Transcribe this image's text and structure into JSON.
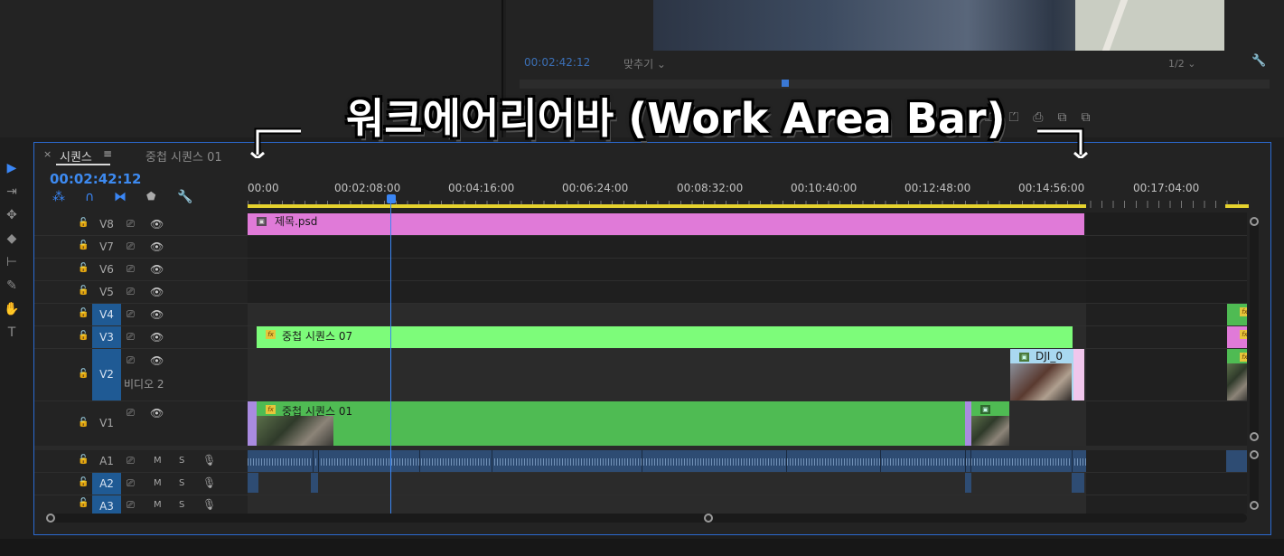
{
  "overlay": {
    "title": "워크에어리어바 (Work Area Bar)"
  },
  "monitor": {
    "timecode": "00:02:42:12",
    "fit": "맞추기  ⌄",
    "resolution": "1/2  ⌄",
    "controls": "⏍⏍⎙⧉⧉"
  },
  "tabs": {
    "close": "×",
    "sequence": "시퀀스",
    "menu": "≡",
    "nested": "중첩 시퀀스 01"
  },
  "timeline": {
    "timecode": "00:02:42:12",
    "ruler_labels": [
      "00:00",
      "00:02:08:00",
      "00:04:16:00",
      "00:06:24:00",
      "00:08:32:00",
      "00:10:40:00",
      "00:12:48:00",
      "00:14:56:00",
      "00:17:04:00"
    ],
    "work_area": {
      "start": "00:00:00:00",
      "end": "00:14:56:00"
    },
    "playhead": "00:02:42:12"
  },
  "tracks": {
    "video": [
      {
        "name": "V8",
        "active": false
      },
      {
        "name": "V7",
        "active": false
      },
      {
        "name": "V6",
        "active": false
      },
      {
        "name": "V5",
        "active": false
      },
      {
        "name": "V4",
        "active": true
      },
      {
        "name": "V3",
        "active": true
      },
      {
        "name": "V2",
        "active": true,
        "label": "비디오 2"
      },
      {
        "name": "V1",
        "active": false
      }
    ],
    "audio": [
      {
        "name": "A1",
        "active": false,
        "m": "M",
        "s": "S"
      },
      {
        "name": "A2",
        "active": true,
        "m": "M",
        "s": "S"
      },
      {
        "name": "A3",
        "active": true,
        "m": "M",
        "s": "S"
      }
    ]
  },
  "clips": {
    "title_psd": "제목.psd",
    "nested07": "중첩 시퀀스 07",
    "dji": "DJI_0",
    "nested01": "중첩 시퀀스 01",
    "fx": "fx"
  },
  "colors": {
    "accent": "#3a86f5",
    "work_area": "#e5d22e",
    "title_clip": "#e07ad8",
    "nested07_clip": "#7dfc7a",
    "nested01_clip": "#4fbb53",
    "audio_clip": "#2e4c73"
  },
  "icons": [
    "selection-tool-icon",
    "track-select-icon",
    "ripple-edit-icon",
    "razor-icon",
    "slip-icon",
    "pen-icon",
    "hand-icon",
    "type-icon",
    "snap-icon",
    "linked-selection-icon",
    "add-marker-icon",
    "wrench-icon",
    "lock-icon",
    "eye-icon",
    "mic-icon"
  ]
}
